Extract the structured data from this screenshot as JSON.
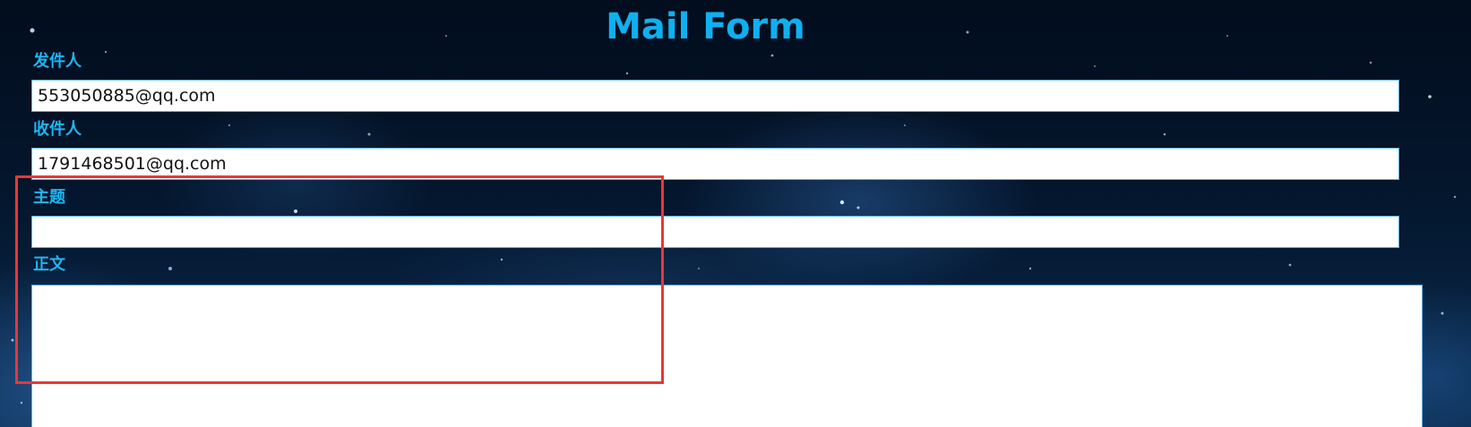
{
  "form": {
    "title": "Mail Form",
    "sender": {
      "label": "发件人",
      "value": "553050885@qq.com"
    },
    "recipient": {
      "label": "收件人",
      "value": "1791468501@qq.com"
    },
    "subject": {
      "label": "主题",
      "value": ""
    },
    "body": {
      "label": "正文",
      "value": ""
    }
  },
  "colors": {
    "title": "#0fb0f0",
    "label": "#1fb6f2",
    "field_border": "#5aaee6",
    "highlight_box": "#e53935",
    "background": "#04162d"
  }
}
